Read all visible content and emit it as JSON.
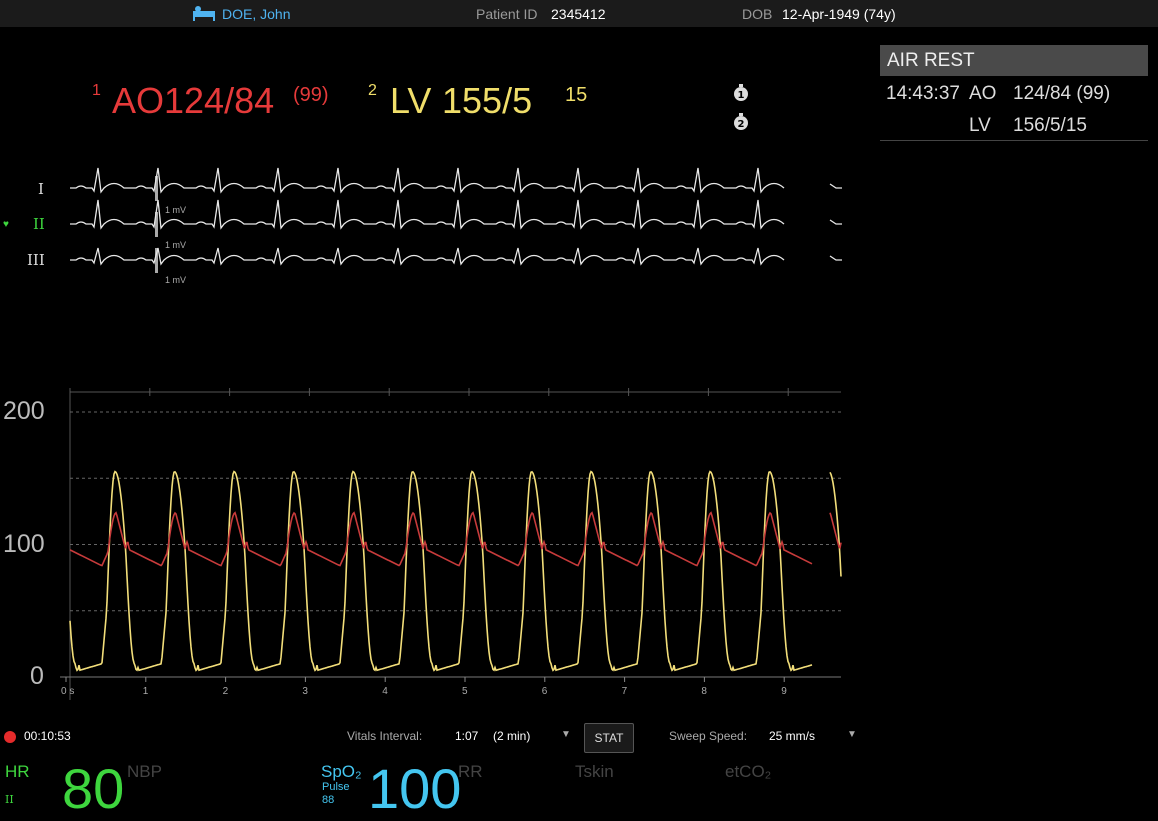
{
  "header": {
    "patient_name": "DOE, John",
    "patient_id_label": "Patient ID",
    "patient_id": "2345412",
    "dob_label": "DOB",
    "dob": "12-Apr-1949 (74y)"
  },
  "pressures": {
    "p1_index": "1",
    "p1_label": "AO",
    "p1_value": "124/84",
    "p1_mean": "(99)",
    "p2_index": "2",
    "p2_label": "LV",
    "p2_value": "155/5",
    "p2_edp": "15"
  },
  "ecg": {
    "leads": [
      "I",
      "II",
      "III"
    ],
    "scale_label": "1 mV"
  },
  "panel": {
    "title": "AIR REST",
    "time": "14:43:37",
    "ao_label": "AO",
    "ao_value": "124/84 (99)",
    "lv_label": "LV",
    "lv_value": "156/5/15"
  },
  "pressure_chart": {
    "y_labels": [
      "200",
      "100",
      "0"
    ],
    "x_labels": [
      "0 s",
      "1",
      "2",
      "3",
      "4",
      "5",
      "6",
      "7",
      "8",
      "9"
    ]
  },
  "bottom": {
    "elapsed": "00:10:53",
    "vitals_interval_label": "Vitals Interval:",
    "vitals_interval_value": "1:07",
    "vitals_interval_period": "(2 min)",
    "stat_label": "STAT",
    "sweep_label": "Sweep Speed:",
    "sweep_value": "25 mm/s"
  },
  "vitals": {
    "hr_label": "HR",
    "hr_lead": "II",
    "hr_value": "80",
    "nbp_label": "NBP",
    "spo2_label": "SpO₂",
    "pulse_label": "Pulse",
    "pulse_value": "88",
    "spo2_value": "100",
    "rr_label": "RR",
    "tskin_label": "Tskin",
    "etco2_label": "etCO₂"
  },
  "colors": {
    "ao": "#e63a3a",
    "lv": "#f0de6a",
    "hr": "#3ed63e",
    "spo2": "#44c6f0"
  }
}
